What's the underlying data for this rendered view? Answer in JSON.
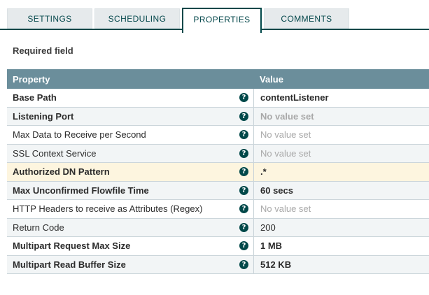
{
  "tabs": [
    {
      "label": "SETTINGS",
      "active": false
    },
    {
      "label": "SCHEDULING",
      "active": false
    },
    {
      "label": "PROPERTIES",
      "active": true
    },
    {
      "label": "COMMENTS",
      "active": false
    }
  ],
  "required_field_label": "Required field",
  "help_icon_glyph": "?",
  "table": {
    "columns": [
      "Property",
      "Value"
    ],
    "rows": [
      {
        "property": "Base Path",
        "value": "contentListener",
        "required": true,
        "value_set": true,
        "highlighted": false
      },
      {
        "property": "Listening Port",
        "value": "No value set",
        "required": true,
        "value_set": false,
        "highlighted": false
      },
      {
        "property": "Max Data to Receive per Second",
        "value": "No value set",
        "required": false,
        "value_set": false,
        "highlighted": false
      },
      {
        "property": "SSL Context Service",
        "value": "No value set",
        "required": false,
        "value_set": false,
        "highlighted": false
      },
      {
        "property": "Authorized DN Pattern",
        "value": ".*",
        "required": true,
        "value_set": true,
        "highlighted": true
      },
      {
        "property": "Max Unconfirmed Flowfile Time",
        "value": "60 secs",
        "required": true,
        "value_set": true,
        "highlighted": false
      },
      {
        "property": "HTTP Headers to receive as Attributes (Regex)",
        "value": "No value set",
        "required": false,
        "value_set": false,
        "highlighted": false
      },
      {
        "property": "Return Code",
        "value": "200",
        "required": false,
        "value_set": true,
        "highlighted": false
      },
      {
        "property": "Multipart Request Max Size",
        "value": "1 MB",
        "required": true,
        "value_set": true,
        "highlighted": false
      },
      {
        "property": "Multipart Read Buffer Size",
        "value": "512 KB",
        "required": true,
        "value_set": true,
        "highlighted": false
      }
    ]
  },
  "colors": {
    "accent_teal": "#004849",
    "table_header_bg": "#6b8e9b",
    "inactive_tab_bg": "#e6eaec",
    "alt_row_bg": "#f2f5f6",
    "highlight_row_bg": "#fdf5df",
    "unset_value_text": "#a8a8a8"
  }
}
